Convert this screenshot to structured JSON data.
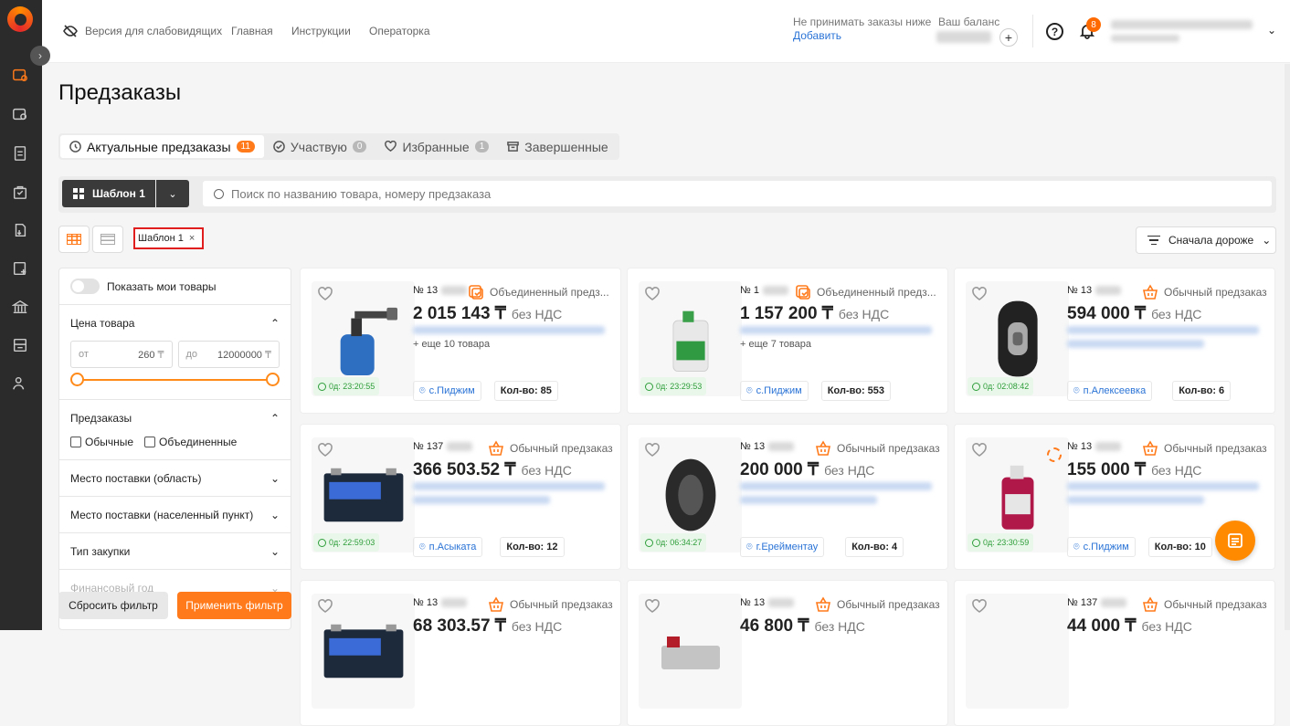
{
  "colors": {
    "accent": "#ff7a1a",
    "link": "#2a73d6",
    "timer": "#2e9e3a",
    "highlight": "#e01e1e"
  },
  "header": {
    "links": [
      "Версия для слабовидящих",
      "Главная",
      "Инструкции",
      "Операторка"
    ],
    "min_order_label": "Не принимать заказы ниже",
    "add_label": "Добавить",
    "balance_label": "Ваш баланс",
    "plus": "+",
    "help": "?",
    "notifications": "8"
  },
  "page_title": "Предзаказы",
  "tabs": [
    {
      "label": "Актуальные предзаказы",
      "count": "11",
      "icon": "clock-icon"
    },
    {
      "label": "Участвую",
      "count": "0",
      "icon": "check-circle-icon"
    },
    {
      "label": "Избранные",
      "count": "1",
      "icon": "heart-icon"
    },
    {
      "label": "Завершенные",
      "count": "",
      "icon": "archive-icon"
    }
  ],
  "toolbar": {
    "template_label": "Шаблон 1",
    "search_placeholder": "Поиск по названию товара, номеру предзаказа"
  },
  "chip": {
    "label": "Шаблон 1",
    "close": "×"
  },
  "sort": {
    "label": "Сначала дороже"
  },
  "filters": {
    "show_my": "Показать мои товары",
    "price": {
      "label": "Цена товара",
      "from_label": "от",
      "from_value": "260",
      "to_label": "до",
      "to_value": "12000000",
      "currency": "₸"
    },
    "preorders": {
      "label": "Предзаказы",
      "options": [
        "Обычные",
        "Объединенные"
      ]
    },
    "collapsed": [
      "Место поставки (область)",
      "Место поставки (населенный пункт)",
      "Тип закупки",
      "Финансовый год"
    ],
    "reset": "Сбросить фильтр",
    "apply": "Применить фильтр"
  },
  "cards": [
    {
      "num": "№ 13",
      "type": "Объединенный предз...",
      "price": "2 015 143 ₸",
      "vat": "без НДС",
      "more": "+ еще 10 товара",
      "timer": "0д: 23:20:55",
      "loc": "с.Пиджим",
      "qty": "Кол-во: 85",
      "img": "blowtorch"
    },
    {
      "num": "№ 1",
      "type": "Объединенный предз...",
      "price": "1 157 200 ₸",
      "vat": "без НДС",
      "more": "+ еще 7 товара",
      "timer": "0д: 23:29:53",
      "loc": "с.Пиджим",
      "qty": "Кол-во: 553",
      "img": "antifreeze-jug"
    },
    {
      "num": "№ 13",
      "type": "Обычный предзаказ",
      "price": "594 000 ₸",
      "vat": "без НДС",
      "more": "",
      "timer": "0д: 02:08:42",
      "loc": "п.Алексеевка",
      "qty": "Кол-во: 6",
      "img": "truck-tire"
    },
    {
      "num": "№ 137",
      "type": "Обычный предзаказ",
      "price": "366 503.52 ₸",
      "vat": "без НДС",
      "more": "",
      "timer": "0д: 22:59:03",
      "loc": "п.Асыката",
      "qty": "Кол-во: 12",
      "img": "battery"
    },
    {
      "num": "№ 13",
      "type": "Обычный предзаказ",
      "price": "200 000 ₸",
      "vat": "без НДС",
      "more": "",
      "timer": "0д: 06:34:27",
      "loc": "г.Ерейментау",
      "qty": "Кол-во: 4",
      "img": "offroad-tire"
    },
    {
      "num": "№ 13",
      "type": "Обычный предзаказ",
      "price": "155 000 ₸",
      "vat": "без НДС",
      "more": "",
      "timer": "0д: 23:30:59",
      "loc": "с.Пиджим",
      "qty": "Кол-во: 10",
      "img": "coolant-bottle"
    },
    {
      "num": "№ 13",
      "type": "Обычный предзаказ",
      "price": "68 303.57 ₸",
      "vat": "без НДС",
      "more": "",
      "timer": "",
      "loc": "",
      "qty": "",
      "img": "battery"
    },
    {
      "num": "№ 13",
      "type": "Обычный предзаказ",
      "price": "46 800 ₸",
      "vat": "без НДС",
      "more": "",
      "timer": "",
      "loc": "",
      "qty": "",
      "img": "canister"
    },
    {
      "num": "№ 137",
      "type": "Обычный предзаказ",
      "price": "44 000 ₸",
      "vat": "без НДС",
      "more": "",
      "timer": "",
      "loc": "",
      "qty": "",
      "img": "none"
    }
  ]
}
